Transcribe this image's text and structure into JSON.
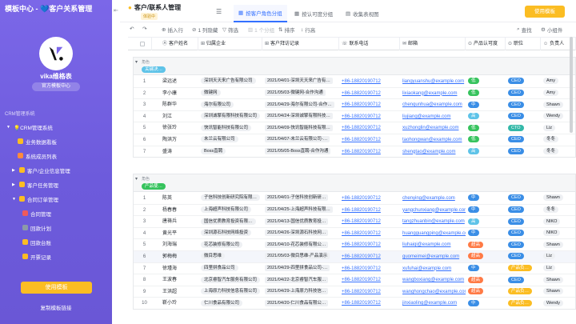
{
  "sidebar": {
    "title": "模板中心 - 💙客户关系管理",
    "space_name": "vika维格表",
    "space_tag": "官方模板中心",
    "section_label": "CRM管理系统",
    "items": [
      {
        "label": "💡CRM管理系统",
        "caret": "▼"
      },
      {
        "label": "业务数据看板",
        "caret": ""
      },
      {
        "label": "系统成员列表",
        "caret": ""
      },
      {
        "label": "客户/企业信息管理",
        "caret": "▶"
      },
      {
        "label": "客户任务管理",
        "caret": "▶"
      },
      {
        "label": "合同订单管理",
        "caret": "▼"
      },
      {
        "label": "合同管理",
        "caret": ""
      },
      {
        "label": "回款计划",
        "caret": ""
      },
      {
        "label": "回款台账",
        "caret": ""
      },
      {
        "label": "开票记录",
        "caret": ""
      }
    ],
    "use_button": "使用模板",
    "copy_link": "复制模板链接"
  },
  "header": {
    "breadcrumb": "客户/联系人管理",
    "sub_badge": "体验中",
    "tabs": [
      {
        "label": "按客户角色分组"
      },
      {
        "label": "按认可度分组"
      },
      {
        "label": "收集表视图"
      }
    ],
    "use_button": "使用模板"
  },
  "toolbar": {
    "insert": "插入行",
    "hidden": "1 列隐藏",
    "filter": "筛选",
    "group": "1 个分组",
    "sort": "排序",
    "row_height": "行高",
    "search": "查找",
    "widget": "小组件"
  },
  "table": {
    "headers": [
      "客户姓名",
      "归属企业",
      "客户拜访记录",
      "联系电话",
      "邮箱",
      "产品认可度",
      "职位",
      "负责人"
    ],
    "group_label": "角色",
    "groups": [
      {
        "name": "关键决…",
        "color": "#5ec3e8",
        "rows": [
          {
            "n": "1",
            "name": "梁远述",
            "company": "深圳天天来广告有限公司",
            "visit": "2021/04/01-深圳天天来广告有…",
            "phone": "+86-18820190712",
            "email": "liangyuanshu@example.com",
            "level": "低",
            "levelColor": "#36c35d",
            "role": "CEO",
            "roleColor": "#3a8ee6",
            "owner": "Amy"
          },
          {
            "n": "2",
            "name": "李小康",
            "company": "微键网",
            "visit": "2021/05/03-微键网-合作沟通",
            "phone": "+86-18820190712",
            "email": "lixiaokang@example.com",
            "level": "低",
            "levelColor": "#36c35d",
            "role": "CEO",
            "roleColor": "#3a8ee6",
            "owner": "Amy"
          },
          {
            "n": "3",
            "name": "陈群华",
            "company": "海尔有限公司",
            "visit": "2021/04/29-海尔有限公司-合作…",
            "phone": "+86-18820190712",
            "email": "chenqunhua@example.com",
            "level": "中",
            "levelColor": "#3a8ee6",
            "role": "CEO",
            "roleColor": "#3a8ee6",
            "owner": "Shawn"
          },
          {
            "n": "4",
            "name": "刘江",
            "company": "深圳诚擎有限科技有限公司",
            "visit": "2021/04/24-深圳诚擎有限科技…",
            "phone": "+86-18820190712",
            "email": "liujiang@example.com",
            "level": "高",
            "levelColor": "#5ec3e8",
            "role": "CEO",
            "roleColor": "#3a8ee6",
            "owner": "Wendy"
          },
          {
            "n": "5",
            "name": "徐张玲",
            "company": "快讯智能科技有限公司",
            "visit": "2021/04/09-快讯智能科技有限…",
            "phone": "+86-18820190712",
            "email": "xuzhonglin@example.com",
            "level": "低",
            "levelColor": "#36c35d",
            "role": "CTO",
            "roleColor": "#33b8a8",
            "owner": "Liz"
          },
          {
            "n": "6",
            "name": "陶洪万",
            "company": "未兰云有限公司",
            "visit": "2021/04/07-未兰云有限公司-…",
            "phone": "+86-18820190712",
            "email": "taohongwan@example.com",
            "level": "低",
            "levelColor": "#36c35d",
            "role": "CEO",
            "roleColor": "#3a8ee6",
            "owner": "冬冬"
          },
          {
            "n": "7",
            "name": "盛涛",
            "company": "Boss直聘",
            "visit": "2021/05/05-Boss直聘-合作沟通",
            "phone": "+86-18820190712",
            "email": "shengtao@example.com",
            "level": "高",
            "levelColor": "#5ec3e8",
            "role": "CEO",
            "roleColor": "#3a8ee6",
            "owner": "冬冬"
          }
        ]
      },
      {
        "name": "产品使…",
        "color": "#36c35d",
        "rows": [
          {
            "n": "1",
            "name": "陈英",
            "company": "子信科技创新研究院有限…",
            "visit": "2021/04/01-子信科技创新研…",
            "phone": "+86-18820190712",
            "email": "chenying@example.com",
            "level": "中",
            "levelColor": "#3a8ee6",
            "role": "CEO",
            "roleColor": "#3a8ee6",
            "owner": "Shawn"
          },
          {
            "n": "2",
            "name": "杨春春",
            "company": "上海超声科技有限公司",
            "visit": "2021/04/25-上海超声科技有限…",
            "phone": "+86-18820190712",
            "email": "yangchunxiang@example.com",
            "level": "中",
            "levelColor": "#3a8ee6",
            "role": "CEO",
            "roleColor": "#3a8ee6",
            "owner": "冬冬"
          },
          {
            "n": "3",
            "name": "唐祷兵",
            "company": "国信优质教育投资有限…",
            "visit": "2021/04/13-国信优质教育投…",
            "phone": "+86-18820190712",
            "email": "tangzhuanbin@example.com",
            "level": "高",
            "levelColor": "#5ec3e8",
            "role": "CEO",
            "roleColor": "#3a8ee6",
            "owner": "NIKO"
          },
          {
            "n": "4",
            "name": "黄光平",
            "company": "深圳源石科技网络投资",
            "visit": "2021/04/26-深圳源石科技网…",
            "phone": "+86-18820190712",
            "email": "huangguangping@example.com",
            "level": "中",
            "levelColor": "#3a8ee6",
            "role": "CEO",
            "roleColor": "#3a8ee6",
            "owner": "NIKO"
          },
          {
            "n": "5",
            "name": "刘海瑞",
            "company": "花芯装修有限公司",
            "visit": "2021/04/10-花芯装修有限公…",
            "phone": "+86-18820190712",
            "email": "liuhaiqi@example.com",
            "level": "超高",
            "levelColor": "#ff7a45",
            "role": "CEO",
            "roleColor": "#3a8ee6",
            "owner": "Shawn"
          },
          {
            "n": "6",
            "name": "郭梅梅",
            "company": "微目思维",
            "visit": "2021/05/03-微目思维-产品演示",
            "phone": "+86-18820190712",
            "email": "guomeimei@example.com",
            "level": "超高",
            "levelColor": "#ff7a45",
            "role": "CEO",
            "roleColor": "#3a8ee6",
            "owner": "Liz"
          },
          {
            "n": "7",
            "name": "徐瑾海",
            "company": "四里拼食品公司",
            "visit": "2021/04/29-四里拼食品公司-…",
            "phone": "+86-18820190712",
            "email": "xufuhai@example.com",
            "level": "中",
            "levelColor": "#3a8ee6",
            "role": "产品负…",
            "roleColor": "#fbbd23",
            "owner": "Liz"
          },
          {
            "n": "8",
            "name": "王波春",
            "company": "北京睿智汽车服务有限公司",
            "visit": "2021/04/22-北京睿智汽车服…",
            "phone": "+86-18820190712",
            "email": "wangboxiang@example.com",
            "level": "超高",
            "levelColor": "#ff7a45",
            "role": "CEO",
            "roleColor": "#3a8ee6",
            "owner": "Shawn"
          },
          {
            "n": "9",
            "name": "王洪超",
            "company": "上海原力科技信息有限公司",
            "visit": "2021/04/29-上海原力科技信…",
            "phone": "+86-18820190712",
            "email": "wanghongchao@example.com",
            "level": "超高",
            "levelColor": "#ff7a45",
            "role": "产品负…",
            "roleColor": "#fbbd23",
            "owner": "Shawn"
          },
          {
            "n": "10",
            "name": "靳小玲",
            "company": "仁川食品有限公司",
            "visit": "2021/04/20-仁川食品有限公…",
            "phone": "+86-18820190712",
            "email": "jinxiaoling@example.com",
            "level": "中",
            "levelColor": "#3a8ee6",
            "role": "产品负…",
            "roleColor": "#fbbd23",
            "owner": "Wendy"
          }
        ]
      }
    ]
  }
}
